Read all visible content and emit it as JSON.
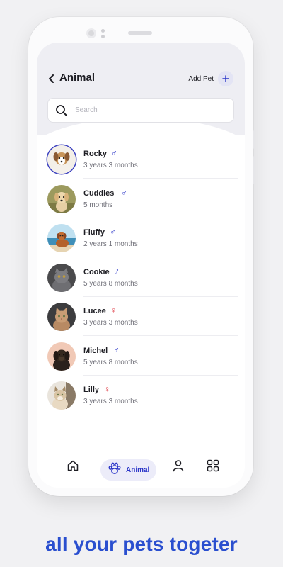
{
  "header": {
    "title": "Animal",
    "add_pet_label": "Add Pet"
  },
  "search": {
    "placeholder": "Search",
    "value": ""
  },
  "pets": [
    {
      "name": "Rocky",
      "gender": "male",
      "gender_symbol": "♂",
      "age": "3 years 3 months",
      "avatar_icon": "dog-photo"
    },
    {
      "name": "Cuddles",
      "gender": "male",
      "gender_symbol": "♂",
      "age": "5 months",
      "avatar_icon": "dog-photo"
    },
    {
      "name": "Fluffy",
      "gender": "male",
      "gender_symbol": "♂",
      "age": "2 years 1 months",
      "avatar_icon": "dog-photo"
    },
    {
      "name": "Cookie",
      "gender": "male",
      "gender_symbol": "♂",
      "age": "5 years 8 months",
      "avatar_icon": "cat-photo"
    },
    {
      "name": "Lucee",
      "gender": "female",
      "gender_symbol": "♀",
      "age": "3 years 3 months",
      "avatar_icon": "cat-photo"
    },
    {
      "name": "Michel",
      "gender": "male",
      "gender_symbol": "♂",
      "age": "5 years 8 months",
      "avatar_icon": "dog-photo"
    },
    {
      "name": "Lilly",
      "gender": "female",
      "gender_symbol": "♀",
      "age": "3 years 3 months",
      "avatar_icon": "cat-photo"
    }
  ],
  "bottom_nav": {
    "items": [
      {
        "icon": "home-icon",
        "label": ""
      },
      {
        "icon": "paw-icon",
        "label": "Animal",
        "active": true
      },
      {
        "icon": "profile-icon",
        "label": ""
      },
      {
        "icon": "grid-icon",
        "label": ""
      }
    ]
  },
  "tagline": "all your pets togeter",
  "colors": {
    "accent": "#2a35c8",
    "tagline": "#2a4fcf",
    "female": "#e0404a",
    "male": "#2a35c8"
  }
}
